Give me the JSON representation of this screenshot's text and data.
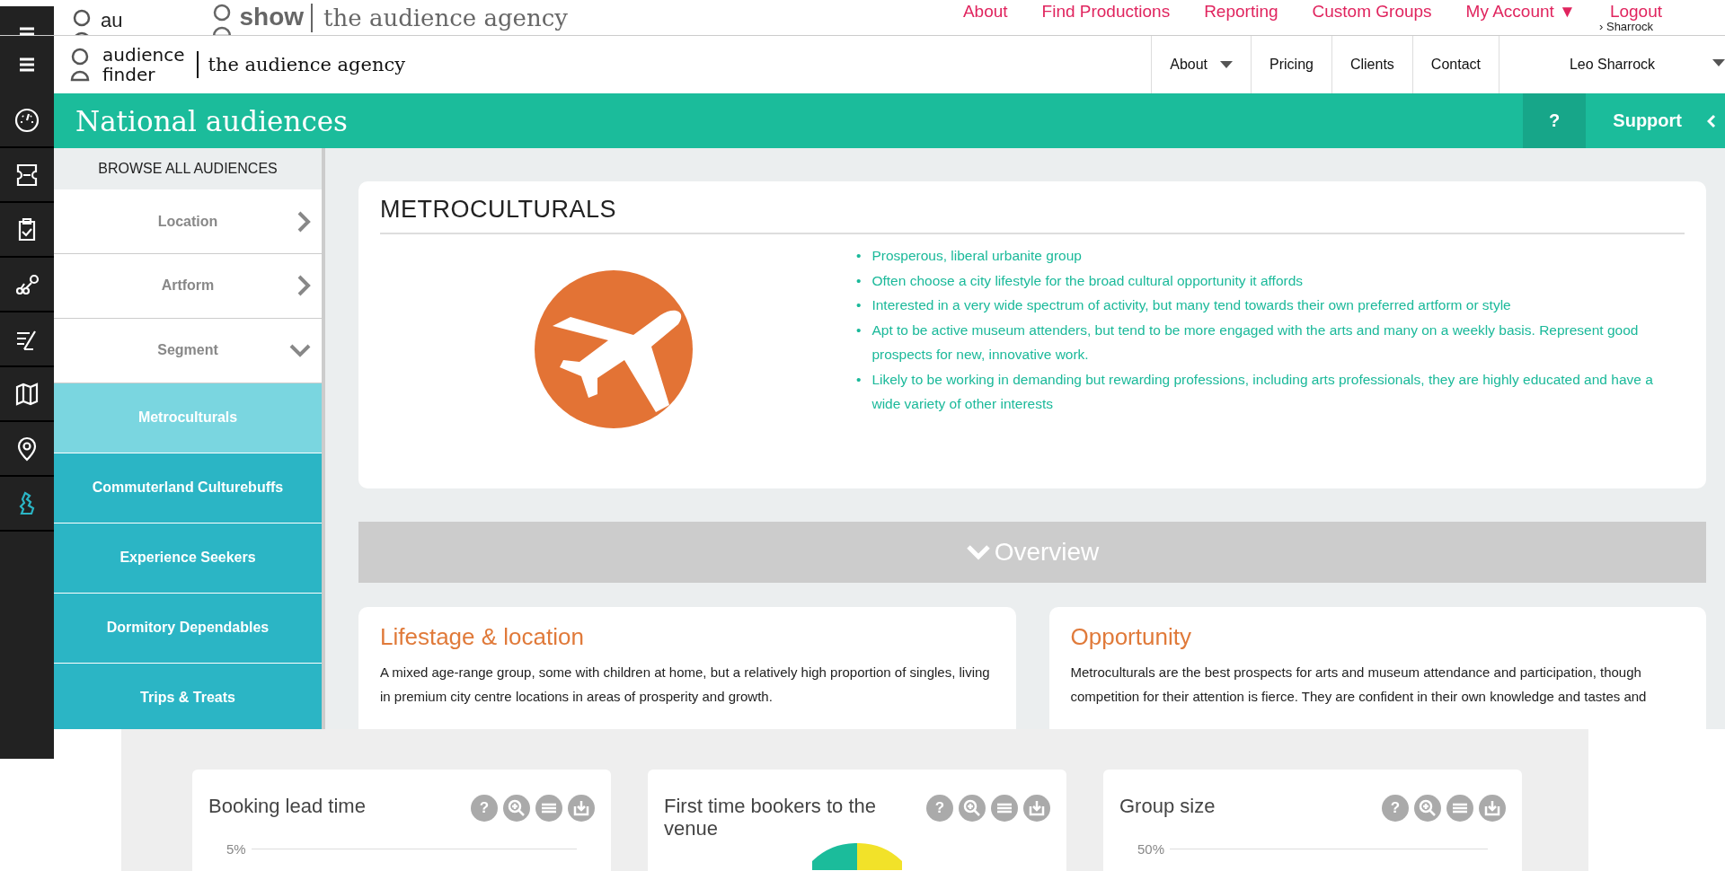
{
  "background_page": {
    "logo_text": "au",
    "brand": "show",
    "agency": "the audience agency",
    "nav": [
      {
        "label": "About"
      },
      {
        "label": "Find Productions"
      },
      {
        "label": "Reporting"
      },
      {
        "label": "Custom Groups"
      },
      {
        "label": "My Account ▼"
      },
      {
        "label": "Logout"
      }
    ],
    "user": "› Sharrock"
  },
  "header": {
    "logo_line1": "audience",
    "logo_line2": "finder",
    "agency": "the audience agency",
    "nav": [
      {
        "label": "About",
        "dropdown": true
      },
      {
        "label": "Pricing",
        "dropdown": false
      },
      {
        "label": "Clients",
        "dropdown": false
      },
      {
        "label": "Contact",
        "dropdown": false
      }
    ],
    "user": "Leo Sharrock"
  },
  "title_bar": {
    "title": "National audiences",
    "help": "?",
    "support": "Support"
  },
  "rail": [
    {
      "kind": "gauge",
      "selected": false
    },
    {
      "kind": "ticket",
      "selected": false
    },
    {
      "kind": "clipboard",
      "selected": false
    },
    {
      "kind": "nodes",
      "selected": false
    },
    {
      "kind": "pen",
      "selected": false
    },
    {
      "kind": "map",
      "selected": false
    },
    {
      "kind": "pin",
      "selected": false
    },
    {
      "kind": "region",
      "selected": true
    }
  ],
  "sidebar": {
    "heading": "BROWSE ALL AUDIENCES",
    "filters": [
      {
        "label": "Location",
        "expanded": false
      },
      {
        "label": "Artform",
        "expanded": false
      },
      {
        "label": "Segment",
        "expanded": true
      }
    ],
    "segments": [
      {
        "label": "Metroculturals",
        "selected": true
      },
      {
        "label": "Commuterland Culturebuffs",
        "selected": false
      },
      {
        "label": "Experience Seekers",
        "selected": false
      },
      {
        "label": "Dormitory Dependables",
        "selected": false
      },
      {
        "label": "Trips & Treats",
        "selected": false
      }
    ]
  },
  "segment_card": {
    "title": "METROCULTURALS",
    "marker": "•",
    "bullets": [
      "Prosperous, liberal urbanite group",
      "Often choose a city lifestyle for the broad cultural opportunity it affords",
      "Interested in a very wide spectrum of activity, but many tend towards their own preferred artform or style",
      "Apt to be active museum attenders, but tend to be more engaged with the arts and many on a weekly basis. Represent good prospects for new, innovative work.",
      "Likely to be working in demanding but rewarding professions, including arts professionals, they are highly educated and have a wide variety of other interests"
    ]
  },
  "overview": {
    "label": "Overview"
  },
  "info_cards": [
    {
      "title": "Lifestage & location",
      "text": "A mixed age-range group, some with children at home, but a relatively high proportion of singles, living in premium city centre locations in areas of prosperity and growth."
    },
    {
      "title": "Opportunity",
      "text": "Metroculturals are the best prospects for arts and museum attendance and participation, though competition for their attention is fierce. They are confident in their own knowledge and tastes and"
    }
  ],
  "chart_cards": [
    {
      "title": "Booking lead time",
      "kind": "axis",
      "tick": "5%",
      "help": "?"
    },
    {
      "title": "First time bookers to the venue",
      "kind": "pie",
      "help": "?"
    },
    {
      "title": "Group size",
      "kind": "axis",
      "tick": "50%",
      "help": "?"
    }
  ]
}
